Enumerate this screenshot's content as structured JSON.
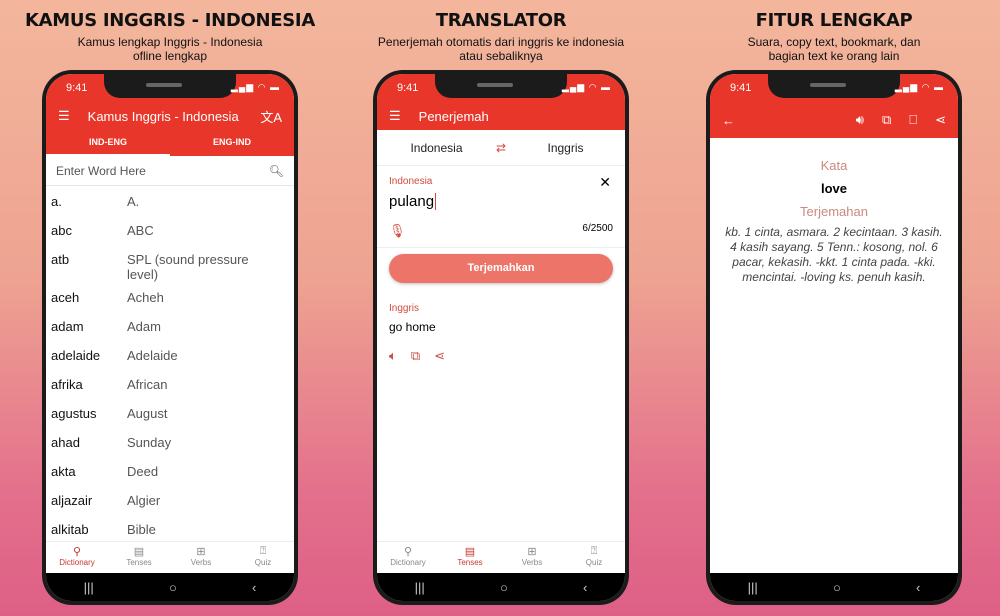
{
  "panels": [
    {
      "title": "KAMUS INGGRIS - INDONESIA",
      "subtitle": "Kamus lengkap Inggris - Indonesia ofline lengkap"
    },
    {
      "title": "TRANSLATOR",
      "subtitle": "Penerjemah otomatis dari inggris ke indonesia atau sebaliknya"
    },
    {
      "title": "FITUR LENGKAP",
      "subtitle": "Suara, copy text, bookmark, dan bagian text ke orang lain"
    }
  ],
  "status_time": "9:41",
  "dictionary": {
    "app_title": "Kamus Inggris - Indonesia",
    "tabs": [
      "IND-ENG",
      "ENG-IND"
    ],
    "search_placeholder": "Enter Word Here",
    "rows": [
      [
        "a.",
        "A."
      ],
      [
        "abc",
        "ABC"
      ],
      [
        "atb",
        "SPL (sound pressure level)"
      ],
      [
        "aceh",
        "Acheh"
      ],
      [
        "adam",
        "Adam"
      ],
      [
        "adelaide",
        "Adelaide"
      ],
      [
        "afrika",
        "African"
      ],
      [
        "agustus",
        "August"
      ],
      [
        "ahad",
        "Sunday"
      ],
      [
        "akta",
        "Deed"
      ],
      [
        "aljazair",
        "Algier"
      ],
      [
        "alkitab",
        "Bible"
      ]
    ]
  },
  "bottom_nav": [
    "Dictionary",
    "Tenses",
    "Verbs",
    "Quiz"
  ],
  "translator": {
    "app_title": "Penerjemah",
    "source_lang": "Indonesia",
    "target_lang": "Inggris",
    "input_label": "Indonesia",
    "input_value": "pulang",
    "char_count": "6/2500",
    "button": "Terjemahkan",
    "output_label": "Inggris",
    "output_value": "go home"
  },
  "detail": {
    "word_label": "Kata",
    "word": "love",
    "translation_label": "Terjemahan",
    "translation": "kb. 1 cinta, asmara. 2 kecintaan. 3 kasih. 4 kasih sayang. 5 Tenn.: kosong, nol. 6 pacar, kekasih. -kkt. 1 cinta pada. -kki. mencintai. -loving ks. penuh kasih."
  },
  "colors": {
    "primary": "#e8372a",
    "button": "#ed7469",
    "label": "#d04b40"
  }
}
